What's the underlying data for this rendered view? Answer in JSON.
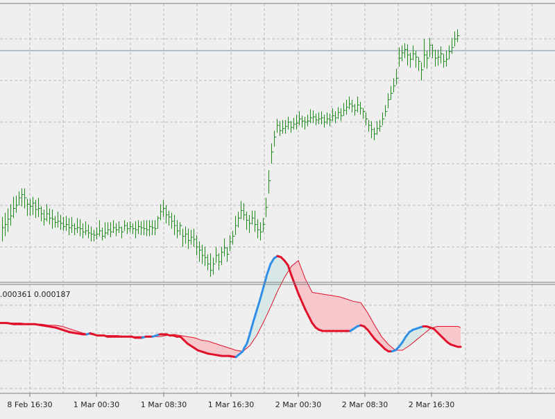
{
  "indicator_values": ".000361 0.000187",
  "x_tick_labels": [
    "8 Feb 16:30",
    "1 Mar 00:30",
    "1 Mar 08:30",
    "1 Mar 16:30",
    "2 Mar 00:30",
    "2 Mar 08:30",
    "2 Mar 16:30"
  ],
  "colors": {
    "background": "#efefef",
    "bars": "#1e8a1e",
    "grid": "#b8b8b8",
    "pane_border": "#7d7d7d",
    "horizontal_line": "#7e8fa0",
    "main_line_rising": "#2f8ee8",
    "main_line_falling": "#e0102a",
    "signal_line": "#e0102a",
    "fill_above": "#d8e8e6",
    "fill_below": "#f6c8cc"
  },
  "chart_data": [
    {
      "type": "ohlc",
      "title": "",
      "grid": true,
      "horizontal_level": 104.2,
      "ylim": [
        80,
        107
      ],
      "x": [
        1,
        2,
        3,
        4,
        5,
        6,
        7,
        8,
        9,
        10,
        11,
        12,
        13,
        14,
        15,
        16,
        17,
        18,
        19,
        20,
        21,
        22,
        23,
        24,
        25,
        26,
        27,
        28,
        29,
        30,
        31,
        32,
        33,
        34,
        35,
        36,
        37,
        38,
        39,
        40,
        41,
        42,
        43,
        44,
        45,
        46,
        47,
        48,
        49,
        50,
        51,
        52,
        53,
        54,
        55,
        56,
        57,
        58,
        59,
        60,
        61,
        62,
        63,
        64,
        65,
        66,
        67,
        68,
        69,
        70,
        71,
        72,
        73,
        74,
        75,
        76,
        77,
        78,
        79,
        80,
        81,
        82,
        83,
        84,
        85,
        86,
        87,
        88,
        89,
        90,
        91,
        92,
        93,
        94,
        95,
        96,
        97,
        98,
        99,
        100,
        101,
        102,
        103,
        104,
        105,
        106,
        107,
        108,
        109,
        110,
        111,
        112,
        113,
        114,
        115,
        116,
        117,
        118,
        119,
        120,
        121,
        122,
        123,
        124,
        125,
        126,
        127,
        128,
        129,
        130,
        131,
        132,
        133,
        134,
        135,
        136,
        137,
        138,
        139,
        140,
        141,
        142,
        143,
        144,
        145,
        146,
        147,
        148,
        149,
        150,
        151,
        152,
        153,
        154,
        155,
        156,
        157,
        158,
        159,
        160,
        161,
        162,
        163,
        164,
        165
      ],
      "close": [
        87.6,
        87.9,
        88.4,
        88.7,
        89.4,
        89.7,
        90.4,
        90.7,
        90.4,
        89.8,
        89.6,
        89.9,
        89.3,
        89.4,
        88.9,
        88.4,
        88.9,
        88.5,
        88.4,
        88.1,
        88.2,
        88.0,
        87.7,
        87.9,
        87.6,
        87.8,
        87.5,
        87.6,
        87.5,
        87.2,
        87.3,
        87.1,
        87.0,
        86.9,
        87.0,
        87.3,
        86.8,
        87.1,
        87.4,
        87.2,
        87.6,
        87.4,
        87.6,
        87.2,
        87.8,
        87.5,
        87.7,
        87.5,
        87.4,
        87.7,
        87.6,
        87.5,
        87.4,
        87.7,
        87.6,
        87.5,
        88.5,
        89.1,
        89.4,
        88.8,
        88.6,
        88.2,
        87.8,
        87.3,
        87.8,
        86.8,
        87.0,
        86.4,
        86.7,
        86.5,
        85.8,
        85.5,
        85.0,
        84.8,
        84.2,
        83.6,
        84.2,
        85.0,
        84.4,
        85.3,
        85.7,
        85.1,
        86.3,
        86.8,
        87.8,
        88.5,
        89.2,
        88.8,
        88.3,
        88.0,
        88.5,
        87.9,
        87.4,
        87.2,
        87.9,
        89.5,
        92.0,
        94.7,
        96.1,
        97.2,
        96.7,
        96.9,
        97.1,
        97.5,
        97.0,
        97.3,
        97.4,
        97.8,
        97.6,
        97.5,
        97.6,
        97.9,
        98.0,
        97.7,
        97.8,
        97.9,
        97.5,
        97.8,
        97.7,
        98.1,
        97.9,
        98.4,
        98.1,
        98.6,
        98.9,
        99.2,
        99.0,
        98.6,
        99.1,
        98.8,
        98.5,
        97.8,
        97.2,
        96.8,
        96.4,
        96.9,
        97.1,
        97.8,
        98.5,
        99.6,
        100.2,
        100.9,
        101.6,
        103.5,
        104.0,
        104.3,
        103.8,
        103.4,
        103.9,
        103.6,
        103.2,
        102.4,
        103.8,
        103.5,
        104.7,
        104.2,
        103.5,
        103.6,
        103.9,
        103.2,
        103.4,
        104.1,
        104.5,
        105.3,
        105.6,
        105.2,
        104.8,
        104.2
      ],
      "high": [
        88.6,
        89.0,
        89.4,
        89.8,
        90.5,
        90.6,
        91.0,
        91.3,
        91.3,
        90.3,
        90.3,
        90.5,
        90.2,
        90.4,
        89.6,
        89.3,
        89.8,
        89.4,
        89.3,
        88.7,
        89.1,
        88.8,
        88.6,
        88.7,
        88.5,
        88.6,
        88.0,
        88.5,
        88.4,
        88.0,
        88.2,
        87.9,
        87.7,
        87.4,
        87.6,
        88.3,
        87.6,
        88.1,
        88.1,
        88.1,
        88.3,
        88.0,
        88.2,
        87.7,
        88.3,
        88.1,
        88.2,
        88.0,
        88.2,
        88.3,
        88.2,
        88.3,
        88.3,
        88.3,
        88.3,
        88.3,
        88.7,
        89.8,
        90.2,
        89.7,
        89.2,
        89.0,
        88.8,
        88.3,
        88.1,
        87.5,
        87.7,
        87.5,
        87.4,
        87.5,
        86.9,
        86.3,
        86.0,
        85.8,
        85.1,
        85.2,
        84.8,
        85.8,
        85.2,
        85.8,
        86.6,
        85.8,
        86.9,
        87.3,
        88.7,
        89.1,
        90.1,
        89.9,
        89.1,
        88.8,
        89.2,
        89.2,
        88.4,
        88.1,
        88.5,
        90.4,
        93.0,
        95.5,
        96.7,
        97.8,
        97.6,
        97.7,
        97.7,
        98.0,
        97.6,
        97.9,
        98.2,
        98.5,
        98.1,
        98.0,
        98.2,
        98.7,
        98.6,
        98.3,
        98.4,
        98.5,
        98.2,
        98.4,
        98.3,
        98.8,
        98.5,
        98.9,
        98.8,
        99.3,
        99.6,
        99.9,
        99.6,
        99.2,
        99.9,
        99.4,
        98.8,
        98.4,
        97.7,
        97.6,
        97.0,
        97.6,
        97.7,
        98.4,
        99.1,
        100.2,
        100.9,
        101.6,
        102.5,
        104.5,
        104.7,
        104.9,
        104.8,
        104.0,
        104.7,
        104.2,
        103.6,
        103.1,
        105.3,
        104.2,
        105.4,
        104.8,
        104.3,
        104.3,
        104.6,
        103.9,
        104.2,
        104.7,
        105.4,
        106.0,
        106.2,
        105.9,
        105.5,
        104.6
      ],
      "low": [
        86.3,
        86.8,
        87.2,
        87.8,
        88.5,
        89.0,
        89.7,
        89.6,
        89.4,
        88.7,
        88.7,
        88.8,
        88.5,
        88.6,
        88.2,
        87.8,
        88.2,
        87.9,
        87.5,
        87.6,
        87.6,
        87.4,
        87.3,
        87.3,
        86.9,
        87.1,
        86.9,
        87.1,
        86.8,
        86.6,
        86.9,
        86.6,
        86.3,
        86.3,
        86.5,
        86.8,
        86.4,
        86.6,
        86.9,
        86.7,
        87.1,
        86.8,
        87.1,
        86.6,
        87.3,
        87.0,
        87.2,
        87.0,
        86.6,
        87.0,
        86.9,
        86.9,
        86.8,
        86.8,
        86.9,
        86.9,
        87.5,
        88.3,
        88.6,
        88.0,
        87.8,
        87.5,
        86.9,
        86.6,
        86.9,
        85.8,
        86.1,
        85.6,
        86.0,
        85.8,
        85.0,
        84.4,
        84.2,
        84.0,
        83.6,
        83.0,
        83.2,
        84.3,
        83.6,
        84.1,
        84.9,
        84.4,
        85.4,
        86.0,
        86.9,
        87.6,
        88.4,
        88.3,
        87.4,
        87.1,
        87.9,
        87.2,
        86.6,
        86.4,
        87.2,
        88.6,
        90.8,
        93.6,
        95.2,
        96.5,
        96.2,
        96.4,
        96.4,
        96.8,
        96.5,
        96.8,
        96.8,
        97.2,
        97.0,
        96.8,
        97.1,
        97.4,
        97.4,
        97.2,
        97.3,
        97.3,
        97.0,
        97.3,
        97.1,
        97.6,
        97.4,
        97.8,
        97.6,
        98.1,
        98.2,
        98.7,
        98.4,
        98.1,
        98.4,
        98.2,
        97.8,
        97.2,
        96.6,
        96.0,
        95.8,
        96.3,
        96.6,
        97.2,
        98.0,
        98.8,
        99.6,
        100.3,
        101.0,
        102.7,
        103.2,
        103.5,
        102.8,
        102.6,
        103.3,
        102.6,
        102.3,
        101.4,
        102.6,
        102.5,
        103.6,
        103.5,
        102.7,
        102.8,
        103.0,
        102.6,
        102.7,
        103.4,
        103.9,
        104.6,
        105.0,
        104.7,
        104.1,
        103.5
      ]
    },
    {
      "type": "line",
      "title": "",
      "grid": true,
      "ylim": [
        -0.004,
        0.007
      ],
      "x_tick_labels": [
        "8 Feb 16:30",
        "1 Mar 00:30",
        "1 Mar 08:30",
        "1 Mar 16:30",
        "2 Mar 00:30",
        "2 Mar 08:30",
        "2 Mar 16:30"
      ],
      "series": [
        {
          "role": "main",
          "x": [
            0,
            10,
            20,
            30,
            40,
            50,
            60,
            70,
            80,
            90,
            100,
            110,
            120,
            125,
            130,
            135,
            140,
            145,
            150,
            155,
            160,
            165,
            170,
            175,
            180,
            185,
            190,
            195,
            200,
            205,
            210,
            215,
            220,
            225,
            230,
            235,
            240,
            245,
            250,
            255,
            260,
            265,
            270,
            275,
            280,
            285,
            290,
            295,
            300,
            310,
            320,
            330,
            340,
            350,
            352,
            356,
            360,
            365,
            370,
            375,
            380,
            385,
            390,
            395,
            400,
            405,
            410,
            415,
            420,
            425,
            430,
            435,
            440,
            445,
            450,
            455,
            460,
            465,
            470,
            475,
            480,
            485,
            490,
            495,
            500,
            505,
            510,
            515,
            520,
            525,
            530,
            535,
            540,
            545,
            550,
            555,
            560,
            565,
            570,
            575,
            580,
            585,
            590,
            595,
            600,
            605,
            610,
            615,
            620,
            625,
            630,
            635,
            640,
            645,
            650,
            655,
            660,
            664
          ],
          "y": [
            0.0003,
            0.0003,
            0.0002,
            0.0002,
            0.0002,
            0.0002,
            0.0001,
            0.0,
            -0.0001,
            -0.0003,
            -0.0005,
            -0.0006,
            -0.0007,
            -0.0007,
            -0.0006,
            -0.0007,
            -0.0008,
            -0.0008,
            -0.0008,
            -0.0009,
            -0.0009,
            -0.0009,
            -0.0009,
            -0.0009,
            -0.0009,
            -0.0009,
            -0.0009,
            -0.001,
            -0.001,
            -0.001,
            -0.0009,
            -0.0009,
            -0.0009,
            -0.0008,
            -0.0007,
            -0.0007,
            -0.0007,
            -0.0008,
            -0.0008,
            -0.0009,
            -0.0009,
            -0.0012,
            -0.0015,
            -0.0017,
            -0.0019,
            -0.0021,
            -0.0022,
            -0.0023,
            -0.0024,
            -0.0025,
            -0.0026,
            -0.0026,
            -0.0027,
            -0.0022,
            -0.0019,
            -0.0015,
            -0.0007,
            0.0004,
            0.0014,
            0.0024,
            0.0035,
            0.0046,
            0.0055,
            0.006,
            0.0062,
            0.0061,
            0.0058,
            0.0054,
            0.0045,
            0.0037,
            0.0029,
            0.0022,
            0.0015,
            0.0009,
            0.0003,
            -0.0001,
            -0.0003,
            -0.0004,
            -0.0004,
            -0.0004,
            -0.0004,
            -0.0004,
            -0.0004,
            -0.0004,
            -0.0004,
            -0.0004,
            -0.0002,
            0.0,
            0.0001,
            0.0,
            -0.0003,
            -0.0007,
            -0.0011,
            -0.0014,
            -0.0017,
            -0.002,
            -0.0022,
            -0.0022,
            -0.0021,
            -0.0018,
            -0.0014,
            -0.0009,
            -0.0005,
            -0.0003,
            -0.0002,
            -0.0001,
            0.0,
            0.0,
            -0.0001,
            -0.0002,
            -0.0005,
            -0.0008,
            -0.0011,
            -0.0014,
            -0.0016,
            -0.0017,
            -0.0018,
            -0.0018
          ]
        },
        {
          "role": "signal",
          "x": [
            0,
            10,
            20,
            30,
            40,
            50,
            60,
            70,
            80,
            90,
            100,
            110,
            120,
            130,
            140,
            150,
            160,
            170,
            180,
            190,
            200,
            210,
            220,
            230,
            240,
            250,
            260,
            270,
            280,
            290,
            300,
            310,
            320,
            330,
            340,
            350,
            360,
            370,
            380,
            390,
            400,
            410,
            420,
            430,
            440,
            450,
            460,
            470,
            480,
            490,
            500,
            510,
            520,
            530,
            540,
            550,
            560,
            570,
            580,
            590,
            600,
            610,
            620,
            630,
            640,
            650,
            660,
            664
          ],
          "y": [
            0.0003,
            0.0003,
            0.0003,
            0.0003,
            0.0002,
            0.0002,
            0.0002,
            0.0001,
            0.0001,
            0.0,
            -0.0002,
            -0.0004,
            -0.0006,
            -0.0007,
            -0.0008,
            -0.0008,
            -0.0008,
            -0.0008,
            -0.0009,
            -0.0009,
            -0.0009,
            -0.0009,
            -0.0009,
            -0.0009,
            -0.0008,
            -0.0007,
            -0.0008,
            -0.0009,
            -0.001,
            -0.0012,
            -0.0013,
            -0.0015,
            -0.0017,
            -0.0019,
            -0.0021,
            -0.0022,
            -0.0017,
            -0.0008,
            0.0004,
            0.0017,
            0.0031,
            0.0043,
            0.0053,
            0.0058,
            0.0042,
            0.003,
            0.0029,
            0.0028,
            0.0027,
            0.0026,
            0.0024,
            0.0022,
            0.0021,
            0.0012,
            0.0001,
            -0.0009,
            -0.0016,
            -0.0021,
            -0.0021,
            -0.0017,
            -0.0012,
            -0.0007,
            -0.0002,
            0.0,
            0.0,
            0.0,
            0.0,
            -0.0001
          ]
        }
      ]
    }
  ]
}
